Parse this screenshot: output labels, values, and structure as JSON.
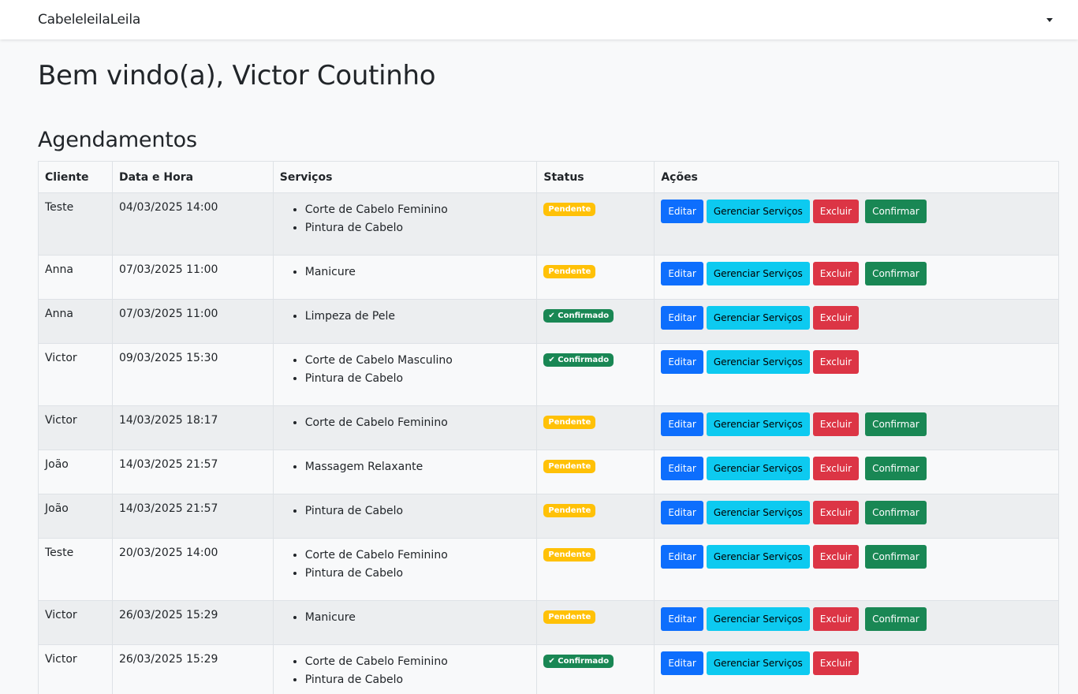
{
  "navbar": {
    "brand": "CabeleleilaLeila"
  },
  "page": {
    "welcome": "Bem vindo(a), Victor Coutinho",
    "section_title": "Agendamentos"
  },
  "table": {
    "headers": [
      "Cliente",
      "Data e Hora",
      "Serviços",
      "Status",
      "Ações"
    ],
    "actions": {
      "edit": "Editar",
      "manage": "Gerenciar Serviços",
      "delete": "Excluir",
      "confirm": "Confirmar"
    },
    "status_labels": {
      "pending": "Pendente",
      "confirmed": "✔ Confirmado"
    },
    "colors": {
      "pending": "#ffc107",
      "confirmed": "#198754",
      "edit": "#0d6efd",
      "manage": "#0dcaf0",
      "delete": "#dc3545",
      "confirm": "#198754"
    },
    "rows": [
      {
        "client": "Teste",
        "datetime": "04/03/2025 14:00",
        "services": [
          "Corte de Cabelo Feminino",
          "Pintura de Cabelo"
        ],
        "status": "pending"
      },
      {
        "client": "Anna",
        "datetime": "07/03/2025 11:00",
        "services": [
          "Manicure"
        ],
        "status": "pending"
      },
      {
        "client": "Anna",
        "datetime": "07/03/2025 11:00",
        "services": [
          "Limpeza de Pele"
        ],
        "status": "confirmed"
      },
      {
        "client": "Victor",
        "datetime": "09/03/2025 15:30",
        "services": [
          "Corte de Cabelo Masculino",
          "Pintura de Cabelo"
        ],
        "status": "confirmed"
      },
      {
        "client": "Victor",
        "datetime": "14/03/2025 18:17",
        "services": [
          "Corte de Cabelo Feminino"
        ],
        "status": "pending"
      },
      {
        "client": "João",
        "datetime": "14/03/2025 21:57",
        "services": [
          "Massagem Relaxante"
        ],
        "status": "pending"
      },
      {
        "client": "João",
        "datetime": "14/03/2025 21:57",
        "services": [
          "Pintura de Cabelo"
        ],
        "status": "pending"
      },
      {
        "client": "Teste",
        "datetime": "20/03/2025 14:00",
        "services": [
          "Corte de Cabelo Feminino",
          "Pintura de Cabelo"
        ],
        "status": "pending"
      },
      {
        "client": "Victor",
        "datetime": "26/03/2025 15:29",
        "services": [
          "Manicure"
        ],
        "status": "pending"
      },
      {
        "client": "Victor",
        "datetime": "26/03/2025 15:29",
        "services": [
          "Corte de Cabelo Feminino",
          "Pintura de Cabelo"
        ],
        "status": "confirmed"
      }
    ]
  }
}
